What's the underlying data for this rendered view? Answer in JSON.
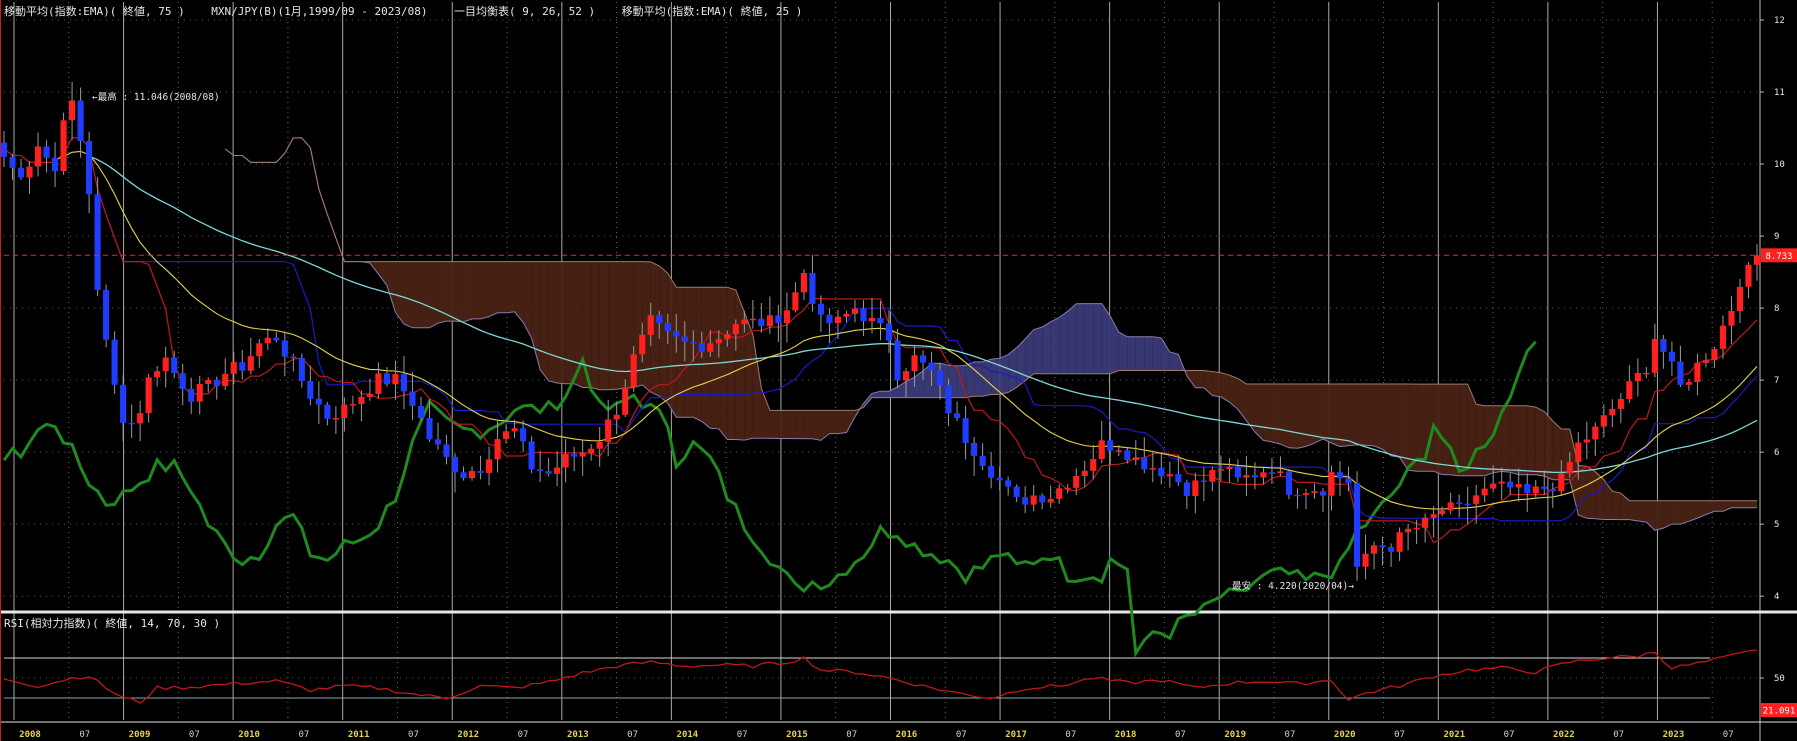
{
  "header": {
    "ema75": "移動平均(指数:EMA)( 終値, 75 )",
    "symbol": "MXN/JPY(B)(1月,1999/09 - 2023/08)",
    "ichimoku": "一目均衡表( 9, 26, 52 )",
    "ema25": "移動平均(指数:EMA)( 終値, 25 )"
  },
  "rsi_header": "RSI(相対力指数)( 終値, 14, 70, 30 )",
  "annotations": {
    "high": "←最高 : 11.046(2008/08)",
    "low": "最安 : 4.220(2020/04)→",
    "last_price": "8.733",
    "last_rsi": "21.091"
  },
  "colors": {
    "background": "#000000",
    "up_candle": "#ff2020",
    "down_candle": "#1f3cff",
    "ema75": "#7fd6d6",
    "ema25": "#e6d34a",
    "tenkan": "#c01818",
    "kijun": "#1a1ac8",
    "chikou": "#1f8a1f",
    "cloud_bull": "#3a3a78",
    "cloud_bear": "#4a2214",
    "rsi": "#c01818",
    "price_tag": "#ff2020"
  },
  "chart_data": [
    {
      "type": "candlestick",
      "title": "MXN/JPY(B)(1月,1999/09 - 2023/08)",
      "y_ticks": [
        "12",
        "11",
        "10",
        "9",
        "8",
        "7",
        "6",
        "5",
        "4"
      ],
      "ylim": [
        3.85,
        12.25
      ],
      "x_ticks": [
        "2008",
        "07",
        "2009",
        "07",
        "2010",
        "07",
        "2011",
        "07",
        "2012",
        "07",
        "2013",
        "07",
        "2014",
        "07",
        "2015",
        "07",
        "2016",
        "07",
        "2017",
        "07",
        "2018",
        "07",
        "2019",
        "07",
        "2020",
        "07",
        "2021",
        "07",
        "2022",
        "07",
        "2023",
        "07"
      ],
      "grid": true,
      "horizontal_line": 8.733,
      "close_anchors": [
        [
          0,
          10.1
        ],
        [
          2,
          9.8
        ],
        [
          4,
          10.3
        ],
        [
          6,
          9.9
        ],
        [
          7,
          10.7
        ],
        [
          8,
          10.8
        ],
        [
          9,
          10.3
        ],
        [
          10,
          9.6
        ],
        [
          11,
          8.3
        ],
        [
          12,
          7.5
        ],
        [
          13,
          6.9
        ],
        [
          14,
          6.5
        ],
        [
          15,
          6.4
        ],
        [
          16,
          6.6
        ],
        [
          17,
          7.0
        ],
        [
          18,
          7.2
        ],
        [
          19,
          7.3
        ],
        [
          20,
          7.1
        ],
        [
          22,
          6.8
        ],
        [
          24,
          6.9
        ],
        [
          26,
          7.1
        ],
        [
          28,
          7.2
        ],
        [
          30,
          7.5
        ],
        [
          32,
          7.6
        ],
        [
          34,
          7.2
        ],
        [
          36,
          6.8
        ],
        [
          38,
          6.5
        ],
        [
          40,
          6.6
        ],
        [
          42,
          6.8
        ],
        [
          44,
          7.0
        ],
        [
          46,
          7.0
        ],
        [
          48,
          6.7
        ],
        [
          50,
          6.2
        ],
        [
          52,
          5.9
        ],
        [
          54,
          5.7
        ],
        [
          56,
          5.8
        ],
        [
          58,
          6.2
        ],
        [
          60,
          6.3
        ],
        [
          62,
          5.8
        ],
        [
          64,
          5.7
        ],
        [
          66,
          5.9
        ],
        [
          68,
          6.0
        ],
        [
          70,
          6.2
        ],
        [
          72,
          6.6
        ],
        [
          74,
          7.3
        ],
        [
          76,
          7.8
        ],
        [
          78,
          7.6
        ],
        [
          80,
          7.5
        ],
        [
          82,
          7.5
        ],
        [
          84,
          7.6
        ],
        [
          86,
          7.8
        ],
        [
          88,
          7.8
        ],
        [
          90,
          7.8
        ],
        [
          92,
          8.0
        ],
        [
          93,
          8.2
        ],
        [
          94,
          8.5
        ],
        [
          96,
          7.8
        ],
        [
          98,
          7.8
        ],
        [
          100,
          8.0
        ],
        [
          102,
          7.8
        ],
        [
          104,
          7.6
        ],
        [
          105,
          7.1
        ],
        [
          107,
          7.3
        ],
        [
          109,
          7.1
        ],
        [
          111,
          6.6
        ],
        [
          113,
          6.2
        ],
        [
          115,
          5.9
        ],
        [
          117,
          5.6
        ],
        [
          119,
          5.3
        ],
        [
          121,
          5.4
        ],
        [
          123,
          5.4
        ],
        [
          125,
          5.6
        ],
        [
          127,
          5.8
        ],
        [
          129,
          6.1
        ],
        [
          131,
          6.1
        ],
        [
          133,
          5.9
        ],
        [
          135,
          5.8
        ],
        [
          137,
          5.7
        ],
        [
          139,
          5.5
        ],
        [
          141,
          5.6
        ],
        [
          143,
          5.8
        ],
        [
          145,
          5.6
        ],
        [
          147,
          5.7
        ],
        [
          149,
          5.8
        ],
        [
          151,
          5.5
        ],
        [
          153,
          5.5
        ],
        [
          155,
          5.5
        ],
        [
          156,
          5.7
        ],
        [
          158,
          5.6
        ],
        [
          159,
          4.4
        ],
        [
          160,
          4.5
        ],
        [
          161,
          4.7
        ],
        [
          163,
          4.7
        ],
        [
          165,
          4.9
        ],
        [
          167,
          5.0
        ],
        [
          169,
          5.2
        ],
        [
          171,
          5.2
        ],
        [
          173,
          5.4
        ],
        [
          175,
          5.5
        ],
        [
          177,
          5.5
        ],
        [
          179,
          5.4
        ],
        [
          181,
          5.5
        ],
        [
          183,
          5.6
        ],
        [
          185,
          6.1
        ],
        [
          187,
          6.3
        ],
        [
          189,
          6.6
        ],
        [
          191,
          6.9
        ],
        [
          193,
          7.2
        ],
        [
          194,
          7.6
        ],
        [
          195,
          7.4
        ],
        [
          197,
          6.9
        ],
        [
          199,
          7.2
        ],
        [
          201,
          7.5
        ],
        [
          203,
          8.0
        ],
        [
          204,
          8.4
        ],
        [
          205,
          8.5
        ],
        [
          206,
          8.733
        ]
      ]
    },
    {
      "type": "line",
      "title": "RSI(相対力指数)( 終値, 14, 70, 30 )",
      "y_ticks": [
        "50"
      ],
      "levels": [
        70,
        30
      ],
      "last_value": 21.091,
      "anchors": [
        [
          0,
          49
        ],
        [
          4,
          42
        ],
        [
          8,
          50
        ],
        [
          10,
          52
        ],
        [
          12,
          40
        ],
        [
          14,
          30
        ],
        [
          16,
          26
        ],
        [
          18,
          40
        ],
        [
          22,
          41
        ],
        [
          28,
          45
        ],
        [
          32,
          47
        ],
        [
          36,
          38
        ],
        [
          40,
          42
        ],
        [
          44,
          40
        ],
        [
          48,
          34
        ],
        [
          52,
          30
        ],
        [
          56,
          42
        ],
        [
          60,
          40
        ],
        [
          64,
          46
        ],
        [
          68,
          55
        ],
        [
          72,
          62
        ],
        [
          76,
          66
        ],
        [
          80,
          62
        ],
        [
          84,
          63
        ],
        [
          88,
          62
        ],
        [
          92,
          66
        ],
        [
          94,
          70
        ],
        [
          96,
          58
        ],
        [
          100,
          56
        ],
        [
          104,
          50
        ],
        [
          108,
          42
        ],
        [
          112,
          35
        ],
        [
          116,
          30
        ],
        [
          120,
          40
        ],
        [
          124,
          42
        ],
        [
          128,
          50
        ],
        [
          132,
          45
        ],
        [
          136,
          48
        ],
        [
          140,
          40
        ],
        [
          144,
          45
        ],
        [
          148,
          47
        ],
        [
          152,
          44
        ],
        [
          156,
          48
        ],
        [
          158,
          28
        ],
        [
          160,
          35
        ],
        [
          164,
          42
        ],
        [
          168,
          52
        ],
        [
          172,
          58
        ],
        [
          176,
          60
        ],
        [
          180,
          56
        ],
        [
          184,
          66
        ],
        [
          188,
          70
        ],
        [
          192,
          72
        ],
        [
          194,
          76
        ],
        [
          196,
          60
        ],
        [
          200,
          66
        ],
        [
          204,
          74
        ],
        [
          206,
          78
        ]
      ]
    }
  ]
}
